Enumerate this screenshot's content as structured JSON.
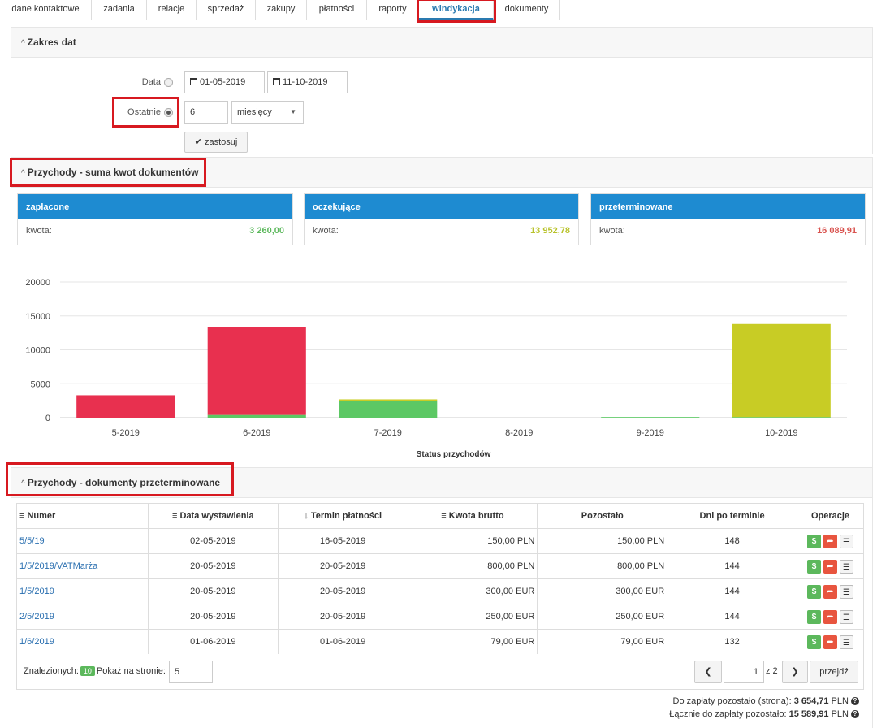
{
  "tabs": [
    {
      "label": "dane kontaktowe",
      "active": false
    },
    {
      "label": "zadania",
      "active": false
    },
    {
      "label": "relacje",
      "active": false
    },
    {
      "label": "sprzedaż",
      "active": false
    },
    {
      "label": "zakupy",
      "active": false
    },
    {
      "label": "płatności",
      "active": false
    },
    {
      "label": "raporty",
      "active": false
    },
    {
      "label": "windykacja",
      "active": true
    },
    {
      "label": "dokumenty",
      "active": false
    }
  ],
  "date_range": {
    "title": "Zakres dat",
    "date_label": "Data",
    "date_from": "01-05-2019",
    "date_to": "11-10-2019",
    "last_label": "Ostatnie",
    "last_value": "6",
    "last_unit": "miesięcy",
    "apply_label": "zastosuj",
    "selected": "last"
  },
  "income_sum": {
    "title": "Przychody - suma kwot dokumentów",
    "cards": [
      {
        "title": "zapłacone",
        "label": "kwota:",
        "value": "3 260,00",
        "color": "#5cb85c"
      },
      {
        "title": "oczekujące",
        "label": "kwota:",
        "value": "13 952,78",
        "color": "#b8c22a"
      },
      {
        "title": "przeterminowane",
        "label": "kwota:",
        "value": "16 089,91",
        "color": "#d9534f"
      }
    ]
  },
  "chart_data": {
    "type": "bar",
    "stacked": true,
    "categories": [
      "5-2019",
      "6-2019",
      "7-2019",
      "8-2019",
      "9-2019",
      "10-2019"
    ],
    "series": [
      {
        "values": [
          0,
          400,
          2400,
          0,
          100,
          100
        ],
        "color": "#5cc864"
      },
      {
        "values": [
          0,
          0,
          300,
          0,
          0,
          13700
        ],
        "color": "#c8cc25"
      },
      {
        "values": [
          3300,
          12900,
          0,
          0,
          0,
          0
        ],
        "color": "#e8304f"
      }
    ],
    "y_ticks": [
      "20000",
      "15000",
      "10000",
      "5000",
      "0"
    ],
    "ylim": [
      0,
      20000
    ],
    "xlabel": "Status przychodów",
    "ylabel": "",
    "grid": true
  },
  "overdue": {
    "title": "Przychody - dokumenty przeterminowane",
    "headers": {
      "numer": "Numer",
      "data_wystawienia": "Data wystawienia",
      "termin": "Termin płatności",
      "kwota": "Kwota brutto",
      "pozostalo": "Pozostało",
      "dni": "Dni po terminie",
      "operacje": "Operacje"
    },
    "rows": [
      {
        "numer": "5/5/19",
        "data": "02-05-2019",
        "termin": "16-05-2019",
        "kwota": "150,00 PLN",
        "pozostalo": "150,00 PLN",
        "dni": "148"
      },
      {
        "numer": "1/5/2019/VATMarża",
        "data": "20-05-2019",
        "termin": "20-05-2019",
        "kwota": "800,00 PLN",
        "pozostalo": "800,00 PLN",
        "dni": "144"
      },
      {
        "numer": "1/5/2019",
        "data": "20-05-2019",
        "termin": "20-05-2019",
        "kwota": "300,00 EUR",
        "pozostalo": "300,00 EUR",
        "dni": "144"
      },
      {
        "numer": "2/5/2019",
        "data": "20-05-2019",
        "termin": "20-05-2019",
        "kwota": "250,00 EUR",
        "pozostalo": "250,00 EUR",
        "dni": "144"
      },
      {
        "numer": "1/6/2019",
        "data": "01-06-2019",
        "termin": "01-06-2019",
        "kwota": "79,00 EUR",
        "pozostalo": "79,00 EUR",
        "dni": "132"
      }
    ],
    "found_label": "Znalezionych:",
    "found_count": "10",
    "per_page_label": "Pokaż na stronie:",
    "per_page": "5",
    "page": "1",
    "page_of": "z 2",
    "go_label": "przejdź"
  },
  "totals": {
    "page_label": "Do zapłaty pozostało (strona):",
    "page_value": "3 654,71",
    "page_currency": "PLN",
    "total_label": "Łącznie do zapłaty pozostało:",
    "total_value": "15 589,91",
    "total_currency": "PLN"
  }
}
